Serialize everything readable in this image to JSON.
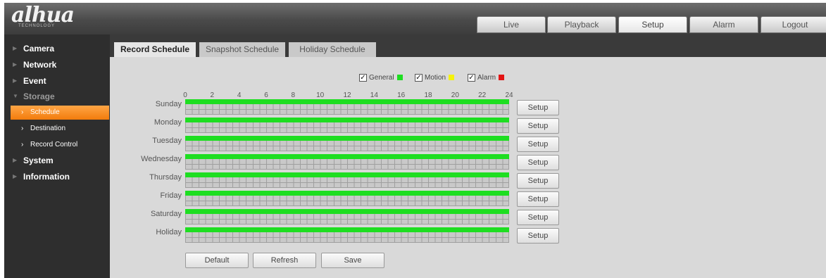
{
  "brand": {
    "logo": "alhua",
    "sub": "TECHNOLOGY"
  },
  "nav_tabs": [
    "Live",
    "Playback",
    "Setup",
    "Alarm",
    "Logout"
  ],
  "active_nav_tab": "Setup",
  "sidebar": {
    "items": [
      {
        "label": "Camera"
      },
      {
        "label": "Network"
      },
      {
        "label": "Event"
      },
      {
        "label": "Storage"
      },
      {
        "label": "Schedule"
      },
      {
        "label": "Destination"
      },
      {
        "label": "Record Control"
      },
      {
        "label": "System"
      },
      {
        "label": "Information"
      }
    ]
  },
  "content_tabs": [
    "Record Schedule",
    "Snapshot Schedule",
    "Holiday Schedule"
  ],
  "active_content_tab": "Record Schedule",
  "legend": [
    {
      "label": "General",
      "checked": true,
      "color": "#1ede21"
    },
    {
      "label": "Motion",
      "checked": true,
      "color": "#f5f20c"
    },
    {
      "label": "Alarm",
      "checked": true,
      "color": "#e31414"
    }
  ],
  "hour_ticks": [
    "0",
    "2",
    "4",
    "6",
    "8",
    "10",
    "12",
    "14",
    "16",
    "18",
    "20",
    "22",
    "24"
  ],
  "days": [
    "Sunday",
    "Monday",
    "Tuesday",
    "Wednesday",
    "Thursday",
    "Friday",
    "Saturday",
    "Holiday"
  ],
  "schedule_coverage_hours": [
    0,
    24
  ],
  "setup_label": "Setup",
  "buttons": {
    "default": "Default",
    "refresh": "Refresh",
    "save": "Save"
  }
}
